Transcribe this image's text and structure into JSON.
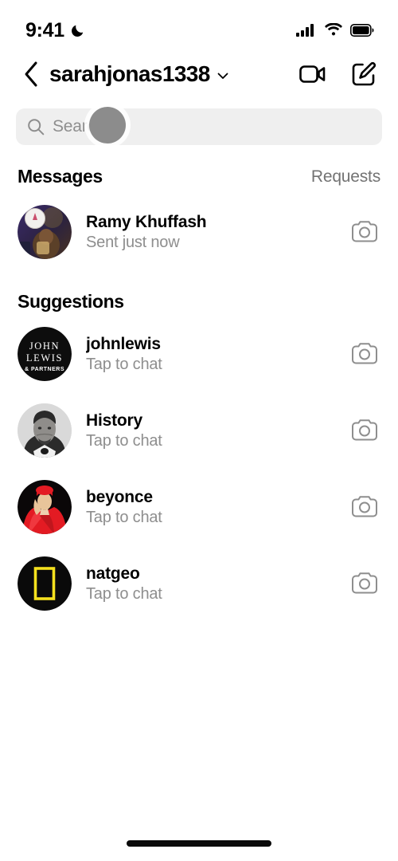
{
  "status_bar": {
    "time": "9:41",
    "dnd_icon": "crescent-moon-icon",
    "cellular_icon": "signal-bars-icon",
    "wifi_icon": "wifi-icon",
    "battery_icon": "battery-full-icon"
  },
  "header": {
    "back_icon": "chevron-left-icon",
    "username": "sarahjonas1338",
    "dropdown_icon": "chevron-down-icon",
    "video_call_icon": "video-camera-icon",
    "compose_icon": "compose-pencil-icon"
  },
  "search": {
    "placeholder": "Search",
    "value": "",
    "icon": "search-icon"
  },
  "messages_section": {
    "title": "Messages",
    "action_label": "Requests",
    "items": [
      {
        "name": "Ramy Khuffash",
        "subtitle": "Sent just now",
        "avatar": "ramy-photo",
        "camera_icon": "camera-icon"
      }
    ]
  },
  "suggestions_section": {
    "title": "Suggestions",
    "items": [
      {
        "name": "johnlewis",
        "subtitle": "Tap to chat",
        "avatar": "john-lewis-logo",
        "avatar_text_line1": "JOHN",
        "avatar_text_line2": "LEWIS",
        "avatar_text_line3": "& PARTNERS",
        "camera_icon": "camera-icon"
      },
      {
        "name": "History",
        "subtitle": "Tap to chat",
        "avatar": "lincoln-portrait",
        "camera_icon": "camera-icon"
      },
      {
        "name": "beyonce",
        "subtitle": "Tap to chat",
        "avatar": "beyonce-photo",
        "camera_icon": "camera-icon"
      },
      {
        "name": "natgeo",
        "subtitle": "Tap to chat",
        "avatar": "natgeo-logo",
        "camera_icon": "camera-icon"
      }
    ]
  },
  "touch_indicator": {
    "name": "touch-point"
  },
  "home_indicator": {
    "name": "home-indicator"
  },
  "colors": {
    "text_primary": "#000000",
    "text_secondary": "#8e8e8e",
    "text_tertiary": "#737373",
    "search_bg": "#efefef",
    "natgeo_yellow": "#f5e11e",
    "beyonce_red": "#e31b23"
  }
}
